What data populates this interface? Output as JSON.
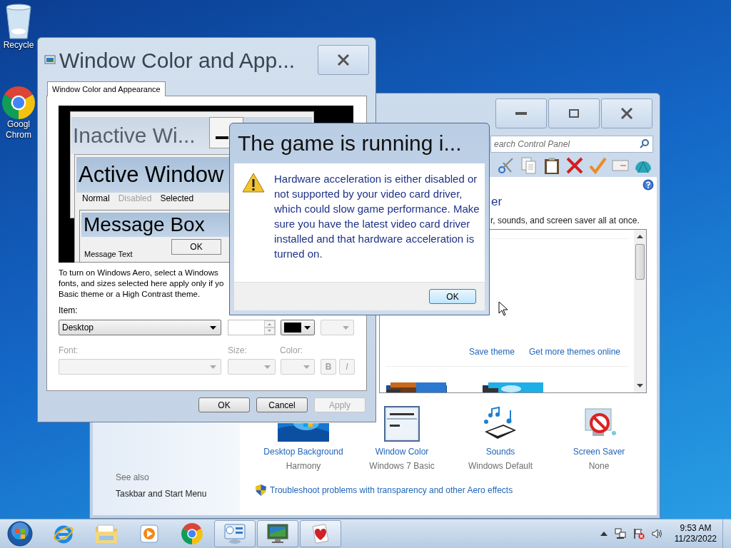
{
  "desktop_icons": [
    {
      "kind": "recycle-bin",
      "label_lines": [
        "Recycle"
      ]
    },
    {
      "kind": "browser",
      "label_lines": [
        "Googl",
        "Chrom"
      ]
    }
  ],
  "control_panel": {
    "search": {
      "placeholder": "earch Control Panel"
    },
    "heading": "er",
    "description": "r, sounds, and screen saver all at once.",
    "theme_links": [
      "Save theme",
      "Get more themes online"
    ],
    "theme_thumbnails": [
      {
        "kind": "picture"
      },
      {
        "kind": "picture"
      }
    ],
    "items": [
      {
        "kind": "desktop-background",
        "label": "Desktop Background",
        "value": "Harmony"
      },
      {
        "kind": "window-color",
        "label": "Window Color",
        "value": "Windows 7 Basic"
      },
      {
        "kind": "sounds",
        "label": "Sounds",
        "value": "Windows Default"
      },
      {
        "kind": "screen-saver",
        "label": "Screen Saver",
        "value": "None"
      }
    ],
    "troubleshoot_link": "Troubleshoot problems with transparency and other Aero effects",
    "see_also": {
      "heading": "See also",
      "links": [
        "Taskbar and Start Menu"
      ]
    }
  },
  "window_color_dialog": {
    "title": "Window Color and App...",
    "tabs": [
      {
        "label": "Window Color and Appearance",
        "selected": true
      }
    ],
    "preview": {
      "inactive_title": "Inactive Wi...",
      "active_title": "Active Window",
      "menu": [
        {
          "label": "Normal",
          "disabled": false
        },
        {
          "label": "Disabled",
          "disabled": true
        },
        {
          "label": "Selected",
          "disabled": false
        }
      ],
      "message_title": "Message Box",
      "message_text": "Message Text",
      "message_button": "OK"
    },
    "note_lines": [
      "To turn on Windows Aero, select a Windows",
      "fonts, and sizes selected here apply only if yo",
      "Basic theme or a High Contrast theme."
    ],
    "item": {
      "label": "Item:",
      "value": "Desktop",
      "color": "#000000"
    },
    "font": {
      "label": "Font:",
      "disabled": true
    },
    "size": {
      "label": "Size:",
      "disabled": true
    },
    "font_color": {
      "label": "Color:",
      "disabled": true
    },
    "style_buttons": [
      {
        "label": "B",
        "kind": "bold"
      },
      {
        "label": "I",
        "kind": "italic"
      }
    ],
    "buttons": [
      {
        "label": "OK",
        "disabled": false
      },
      {
        "label": "Cancel",
        "disabled": false
      },
      {
        "label": "Apply",
        "disabled": true
      }
    ]
  },
  "game_dialog": {
    "title": "The game is running i...",
    "message": "Hardware acceleration is either disabled or not supported by your video card driver, which could slow game performance. Make sure you have the latest video card driver installed and that hardware acceleration is turned on.",
    "button": "OK"
  },
  "taskbar": {
    "apps": [
      {
        "kind": "ie",
        "running": false
      },
      {
        "kind": "explorer",
        "running": false
      },
      {
        "kind": "media",
        "running": false
      },
      {
        "kind": "browser",
        "running": false
      },
      {
        "kind": "control-panel",
        "running": true
      },
      {
        "kind": "monitor",
        "running": true
      },
      {
        "kind": "hearts",
        "running": true
      }
    ],
    "clock": {
      "time": "9:53 AM",
      "date": "11/23/2022"
    }
  }
}
